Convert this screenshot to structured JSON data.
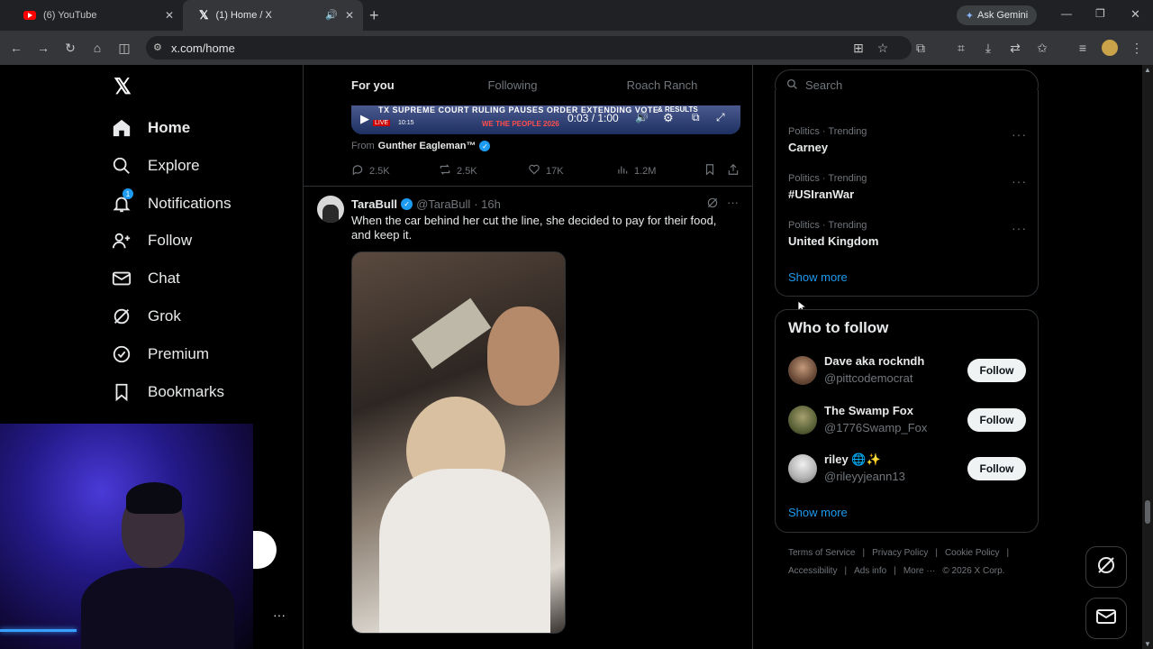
{
  "browser": {
    "tabs": [
      {
        "title": "(6) YouTube",
        "icon": "youtube-icon"
      },
      {
        "title": "(1) Home / X",
        "icon": "x-logo-icon"
      }
    ],
    "url": "x.com/home",
    "gemini_label": "Ask Gemini"
  },
  "nav": {
    "items": [
      {
        "label": "Home",
        "icon": "home-icon"
      },
      {
        "label": "Explore",
        "icon": "search-icon"
      },
      {
        "label": "Notifications",
        "icon": "bell-icon",
        "badge": "1"
      },
      {
        "label": "Follow",
        "icon": "person-add-icon"
      },
      {
        "label": "Chat",
        "icon": "mail-icon"
      },
      {
        "label": "Grok",
        "icon": "grok-icon"
      },
      {
        "label": "Premium",
        "icon": "premium-icon"
      },
      {
        "label": "Bookmarks",
        "icon": "bookmark-icon"
      }
    ]
  },
  "feed": {
    "tabs": [
      "For you",
      "Following",
      "Roach Ranch"
    ],
    "video": {
      "headline": "TX SUPREME COURT RULING PAUSES ORDER EXTENDING VOTE",
      "live": "LIVE",
      "clock": "10:15",
      "brand": "WE THE PEOPLE 2026",
      "results": "& RESULTS",
      "time": "0:03 / 1:00"
    },
    "from_label": "From",
    "from_name": "Gunther Eagleman™",
    "actions1": {
      "replies": "2.5K",
      "reposts": "2.5K",
      "likes": "17K",
      "views": "1.2M"
    },
    "post2": {
      "name": "TaraBull",
      "handle": "@TaraBull",
      "time": "· 16h",
      "text": "When the car behind her cut the line, she decided to pay for their food, and keep it."
    }
  },
  "sidebar": {
    "search_placeholder": "Search",
    "trends": [
      {
        "meta": "Politics · Trending",
        "name": "Carney"
      },
      {
        "meta": "Politics · Trending",
        "name": "#USIranWar"
      },
      {
        "meta": "Politics · Trending",
        "name": "United Kingdom"
      }
    ],
    "show_more": "Show more",
    "who_to_follow_title": "Who to follow",
    "who_to_follow": [
      {
        "name": "Dave aka rockndh",
        "handle": "@pittcodemocrat",
        "button": "Follow",
        "avatar_color": "#8a6a55"
      },
      {
        "name": "The Swamp Fox",
        "handle": "@1776Swamp_Fox",
        "button": "Follow",
        "avatar_color": "#6d7a52"
      },
      {
        "name": "riley 🌐✨",
        "handle": "@rileyyjeann13",
        "button": "Follow",
        "avatar_color": "#d9d9d9"
      }
    ],
    "show_more_2": "Show more",
    "footer": {
      "links_row1": [
        "Terms of Service",
        "|",
        "Privacy Policy",
        "|",
        "Cookie Policy",
        "|"
      ],
      "links_row2": [
        "Accessibility",
        "|",
        "Ads info",
        "|",
        "More ···",
        "© 2026 X Corp."
      ]
    }
  },
  "colors": {
    "accent": "#1d9bf0",
    "border": "#2f3336",
    "muted": "#71767b"
  }
}
